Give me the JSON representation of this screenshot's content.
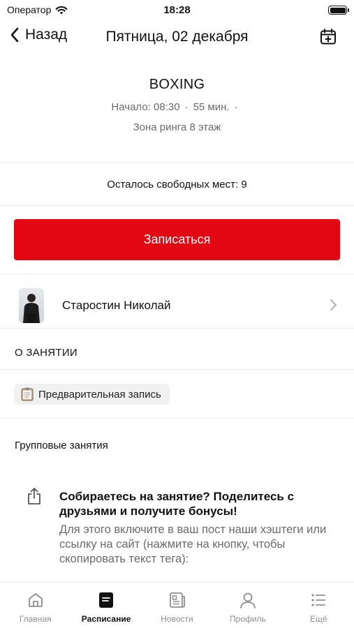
{
  "status_bar": {
    "carrier": "Оператор",
    "time": "18:28"
  },
  "nav": {
    "back_label": "Назад",
    "title": "Пятница, 02 декабря"
  },
  "class": {
    "title": "BOXING",
    "start": "Начало: 08:30",
    "duration": "55 мин.",
    "separator": "·",
    "zone": "Зона ринга 8 этаж",
    "free_seats": "Осталось свободных мест: 9"
  },
  "signup_button": {
    "label": "Записаться",
    "color": "#e30613"
  },
  "trainer": {
    "name": "Старостин Николай"
  },
  "about": {
    "title": "О ЗАНЯТИИ",
    "tag": "Предварительная запись"
  },
  "group": {
    "label": "Групповые занятия"
  },
  "share": {
    "title": "Собираетесь на занятие? Поделитесь с друзьями и получите бонусы!",
    "body": "Для этого включите в ваш пост наши хэштеги или ссылку на сайт (нажмите на кнопку, чтобы скопировать текст тега):"
  },
  "tabbar": {
    "active": "schedule",
    "items": [
      {
        "label": "Главная",
        "icon": "home-icon"
      },
      {
        "label": "Расписание",
        "icon": "schedule-icon"
      },
      {
        "label": "Новости",
        "icon": "news-icon"
      },
      {
        "label": "Профиль",
        "icon": "profile-icon"
      },
      {
        "label": "Ещё",
        "icon": "more-icon"
      }
    ]
  }
}
